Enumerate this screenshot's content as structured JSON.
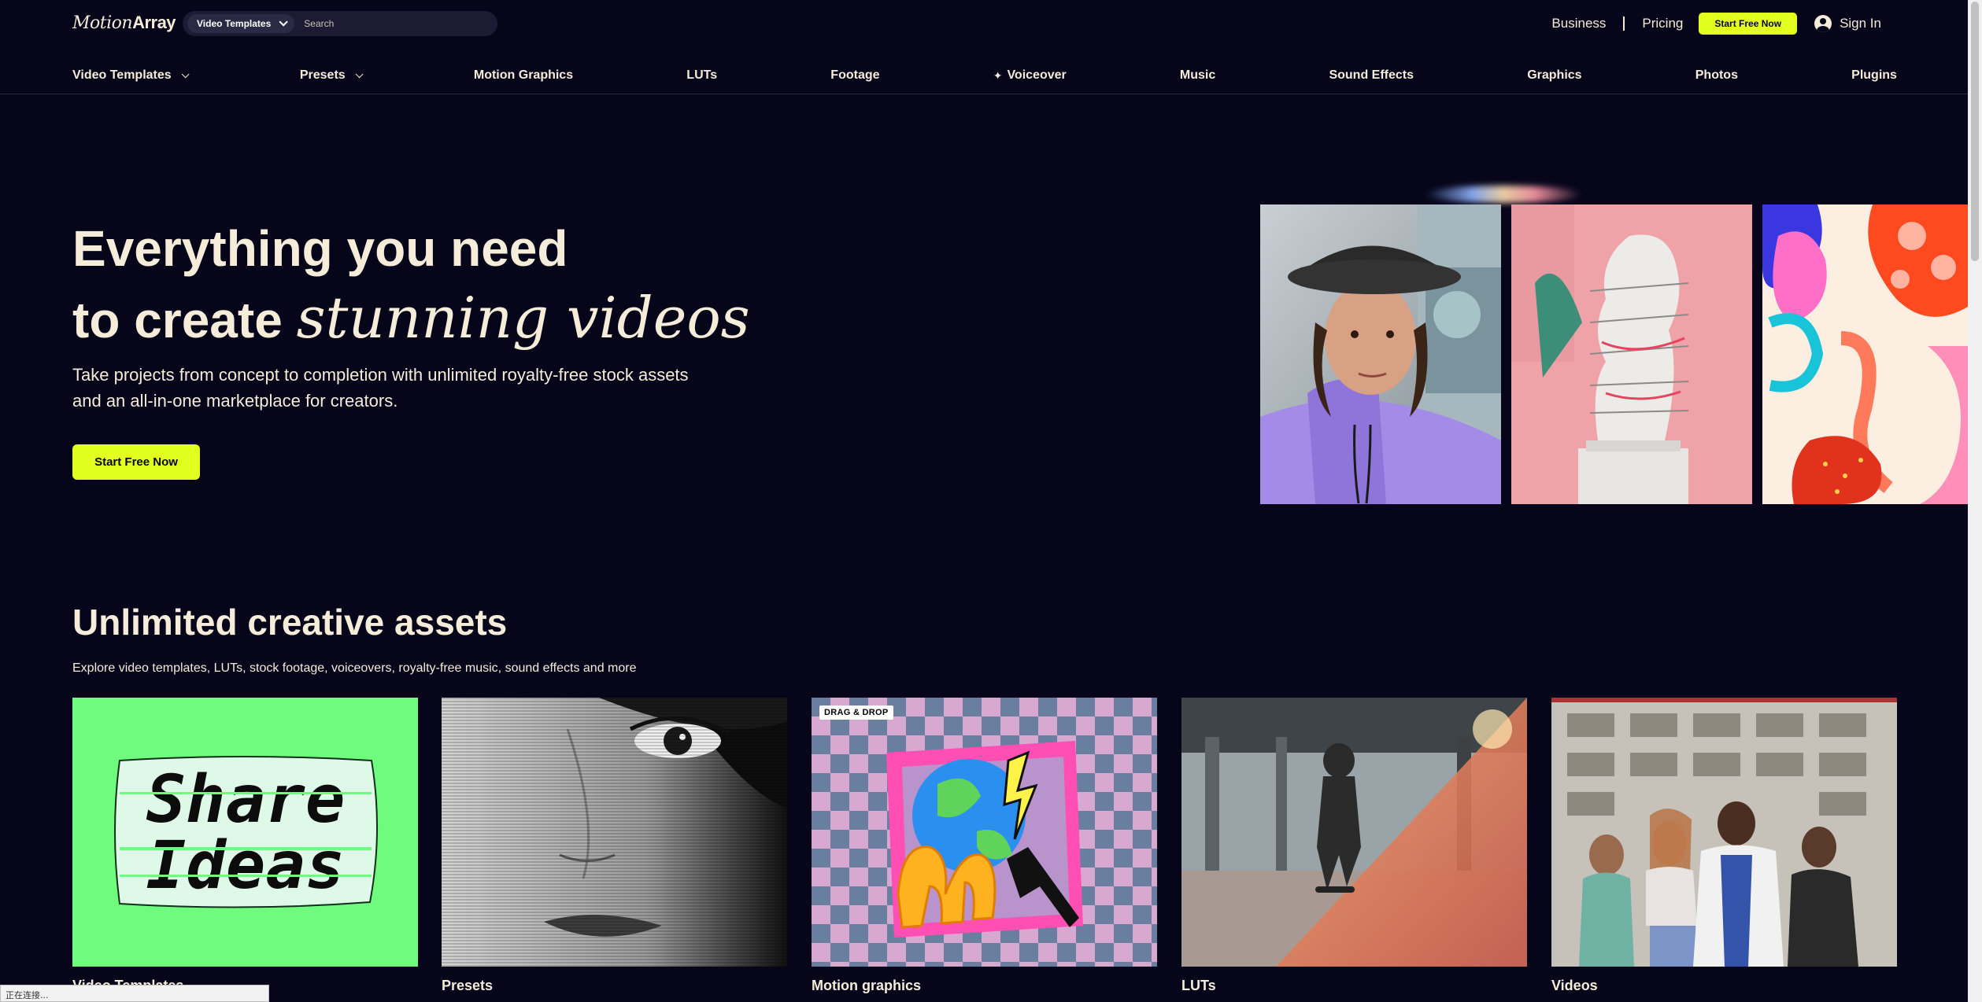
{
  "header": {
    "logo_part1": "Motion",
    "logo_part2": "Array",
    "search_type": "Video Templates",
    "search_placeholder": "Search",
    "links": {
      "business": "Business",
      "pricing": "Pricing"
    },
    "cta": "Start Free Now",
    "signin": "Sign In"
  },
  "nav": [
    "Video Templates",
    "Presets",
    "Motion Graphics",
    "LUTs",
    "Footage",
    "Voiceover",
    "Music",
    "Sound Effects",
    "Graphics",
    "Photos",
    "Plugins"
  ],
  "hero": {
    "title_line1": "Everything you need",
    "title_line2_plain": "to create",
    "title_line2_serif": "stunning videos",
    "subtitle": "Take projects from concept to completion with unlimited royalty-free stock assets and an all-in-one marketplace for creators.",
    "cta": "Start Free Now"
  },
  "assets": {
    "title": "Unlimited creative assets",
    "subtitle": "Explore video templates, LUTs, stock footage, voiceovers, royalty-free music, sound effects and more",
    "cards": [
      {
        "label": "Video Templates",
        "art_text_1": "Share",
        "art_text_2": "Ideas"
      },
      {
        "label": "Presets"
      },
      {
        "label": "Motion graphics",
        "badge": "DRAG & DROP"
      },
      {
        "label": "LUTs"
      },
      {
        "label": "Videos"
      }
    ]
  },
  "status_bar": "正在连接...",
  "colors": {
    "background": "#06051a",
    "accent": "#e2ff1f",
    "text": "#f5ecd9"
  }
}
